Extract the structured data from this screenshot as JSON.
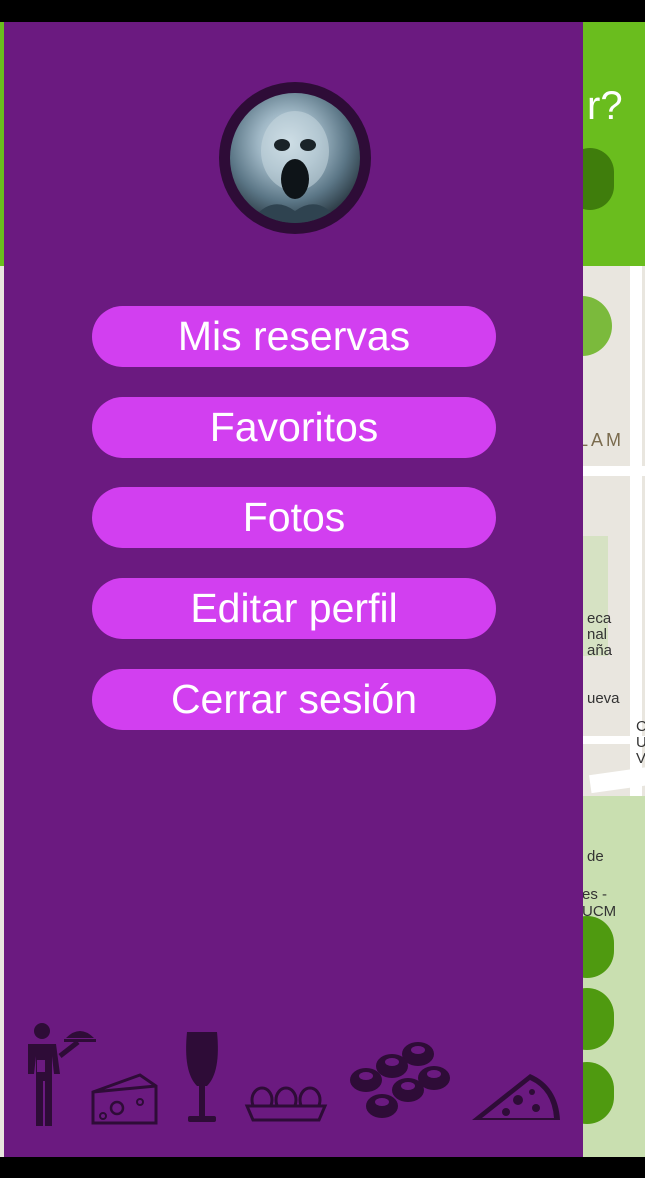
{
  "drawer": {
    "avatar_alt": "Profile picture",
    "menu": [
      {
        "id": "mis-reservas",
        "label": "Mis reservas"
      },
      {
        "id": "favoritos",
        "label": "Favoritos"
      },
      {
        "id": "fotos",
        "label": "Fotos"
      },
      {
        "id": "editar-perfil",
        "label": "Editar perfil"
      },
      {
        "id": "cerrar-sesion",
        "label": "Cerrar sesión"
      }
    ],
    "footer_icons": [
      "waiter-icon",
      "cheese-icon",
      "wine-glass-icon",
      "eggs-icon",
      "sushi-icon",
      "pizza-icon"
    ]
  },
  "background": {
    "header_fragment": "r?",
    "map_labels": {
      "street_fragment": "LAM",
      "label_a": "eca",
      "label_b": "nal",
      "label_c": "aña",
      "label_d": "ueva",
      "label_e": "de",
      "label_f": "es - UCM",
      "label_g": "C",
      "label_h": "U",
      "label_i": "V"
    }
  },
  "colors": {
    "drawer_bg": "#6b1a80",
    "button_bg": "#d23ff0",
    "icon_color": "#2e0c37",
    "header_green": "#6abd1e"
  }
}
